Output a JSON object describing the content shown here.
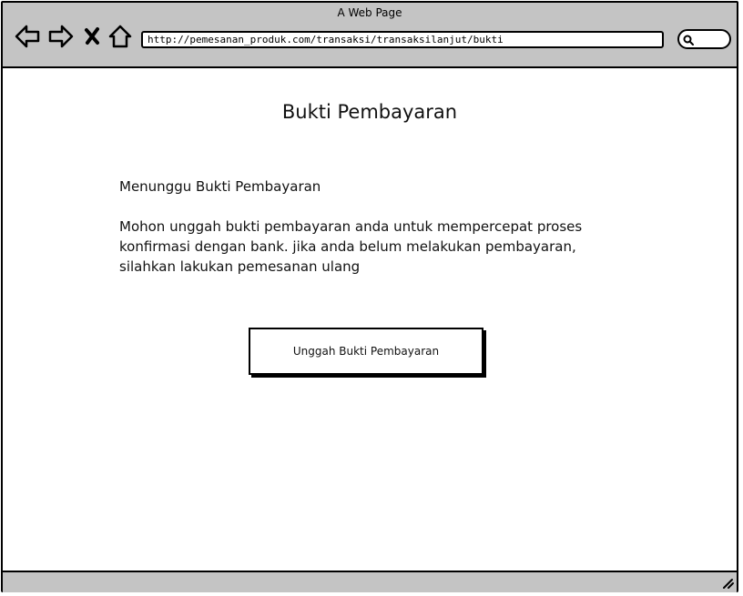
{
  "browser": {
    "window_title": "A Web Page",
    "url": "http://pemesanan_produk.com/transaksi/transaksilanjut/bukti",
    "nav_icons": [
      "back-arrow-icon",
      "forward-arrow-icon",
      "close-x-icon",
      "home-icon"
    ],
    "search_icon": "search-icon"
  },
  "page": {
    "title": "Bukti Pembayaran",
    "status_heading": "Menunggu Bukti Pembayaran",
    "message": "Mohon unggah bukti pembayaran anda untuk mempercepat proses konfirmasi dengan bank. jika anda belum melakukan pembayaran, silahkan lakukan pemesanan ulang",
    "upload_button_label": "Unggah Bukti Pembayaran"
  },
  "colors": {
    "chrome": "#c4c4c4",
    "border": "#000000",
    "background": "#ffffff"
  }
}
